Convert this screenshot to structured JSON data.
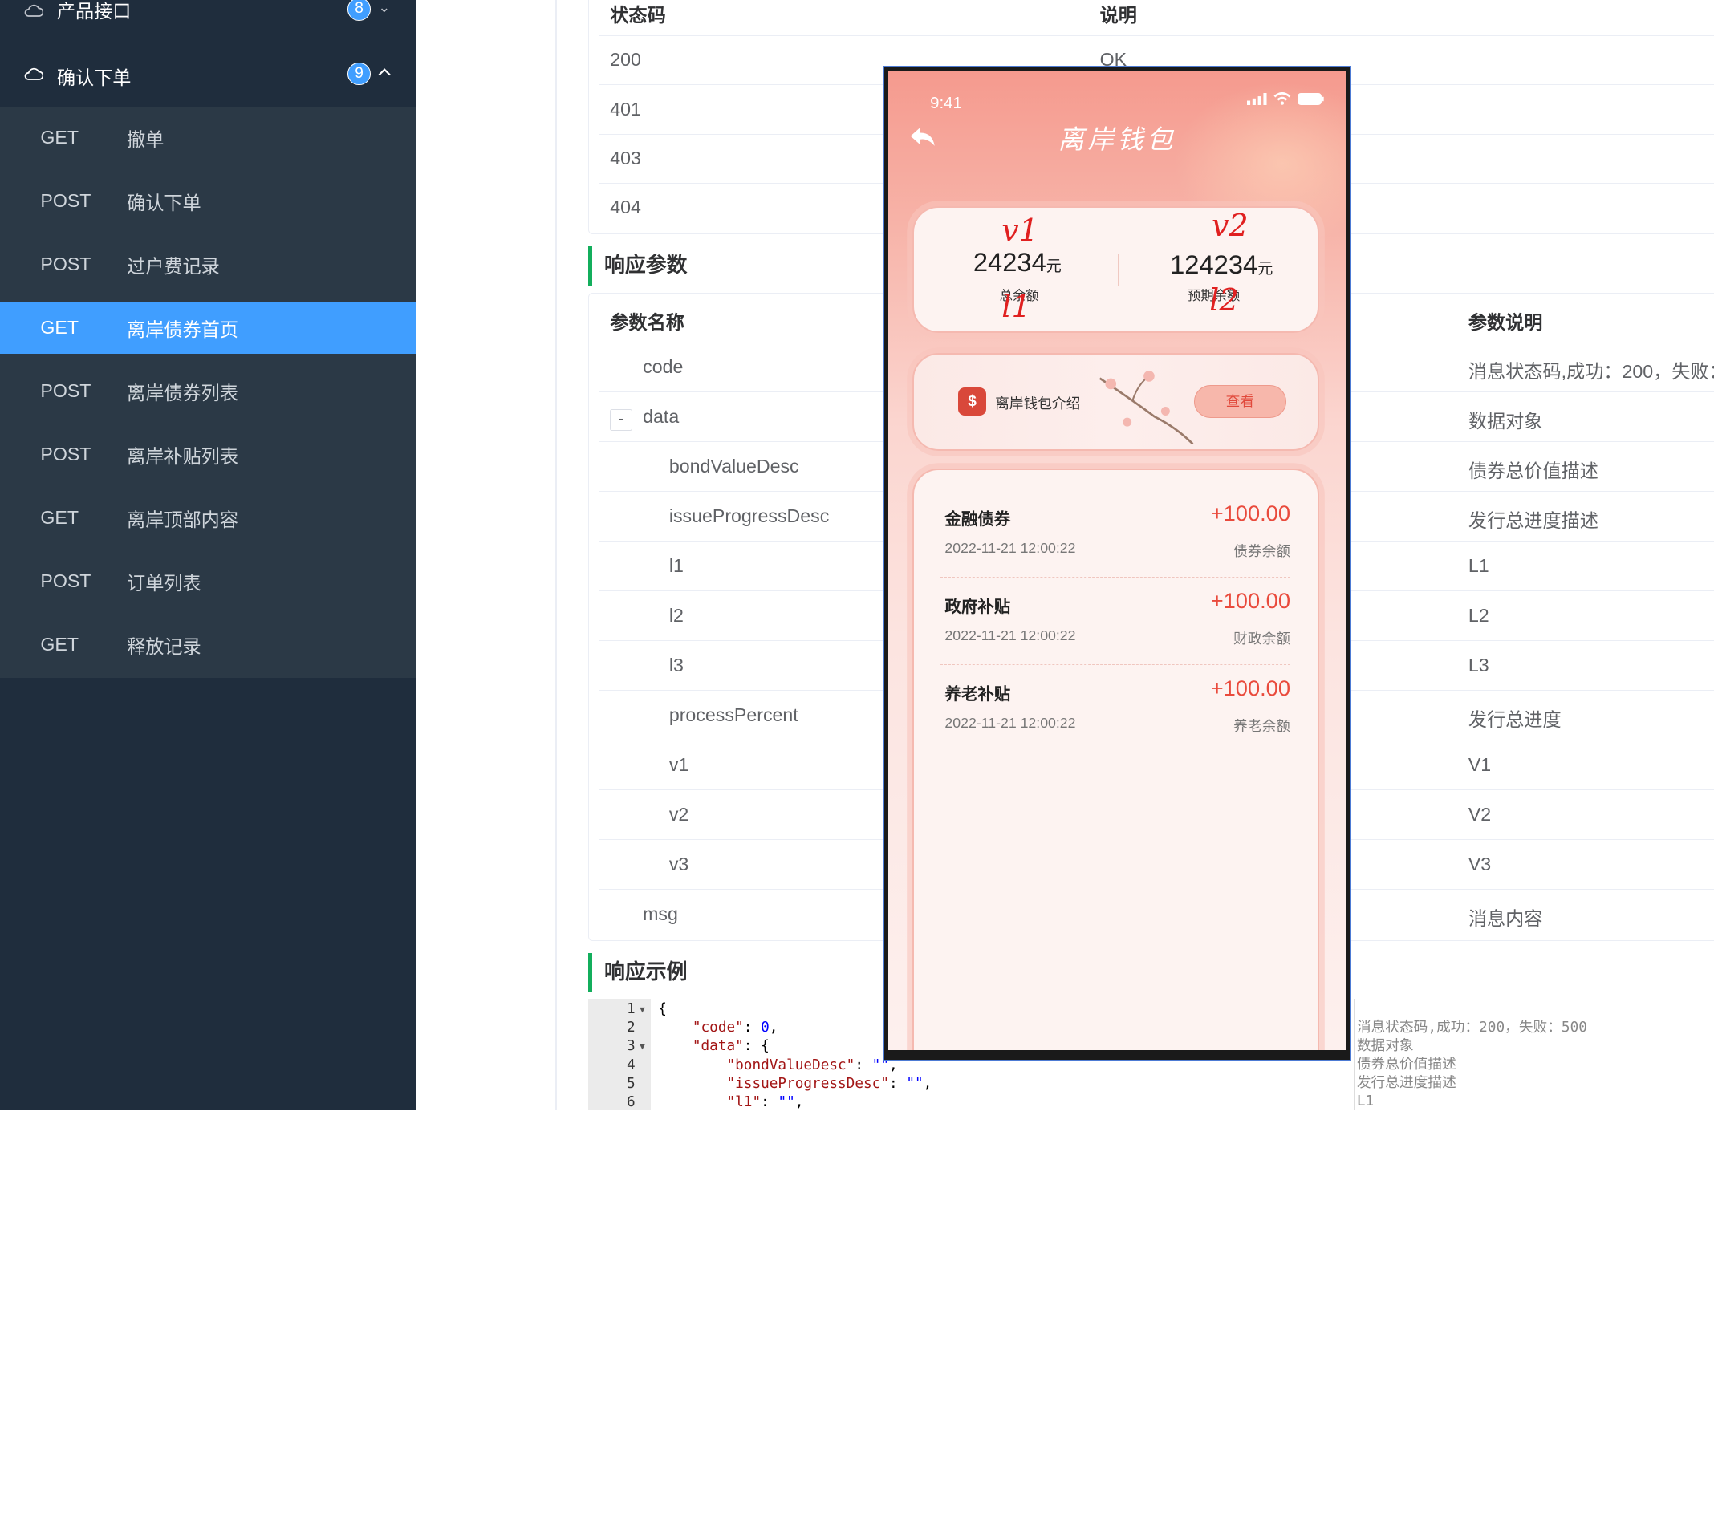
{
  "sidebar": {
    "groups": [
      {
        "title": "产品接口",
        "badge": "8"
      },
      {
        "title": "确认下单",
        "badge": "9"
      }
    ],
    "items": [
      {
        "method": "GET",
        "name": "撤单"
      },
      {
        "method": "POST",
        "name": "确认下单"
      },
      {
        "method": "POST",
        "name": "过户费记录"
      },
      {
        "method": "GET",
        "name": "离岸债券首页"
      },
      {
        "method": "POST",
        "name": "离岸债券列表"
      },
      {
        "method": "POST",
        "name": "离岸补贴列表"
      },
      {
        "method": "GET",
        "name": "离岸顶部内容"
      },
      {
        "method": "POST",
        "name": "订单列表"
      },
      {
        "method": "GET",
        "name": "释放记录"
      }
    ]
  },
  "status_table": {
    "headers": [
      "状态码",
      "说明"
    ],
    "rows": [
      {
        "code": "200",
        "desc": "OK"
      },
      {
        "code": "401",
        "desc": ""
      },
      {
        "code": "403",
        "desc": ""
      },
      {
        "code": "404",
        "desc": ""
      }
    ]
  },
  "response_params": {
    "title": "响应参数",
    "headers": [
      "参数名称",
      "参数说明"
    ],
    "toggle": "-",
    "rows": [
      {
        "name": "code",
        "desc": "消息状态码,成功：200，失败："
      },
      {
        "name": "data",
        "desc": "数据对象"
      },
      {
        "name": "bondValueDesc",
        "desc": "债券总价值描述"
      },
      {
        "name": "issueProgressDesc",
        "desc": "发行总进度描述"
      },
      {
        "name": "l1",
        "desc": "L1"
      },
      {
        "name": "l2",
        "desc": "L2"
      },
      {
        "name": "l3",
        "desc": "L3"
      },
      {
        "name": "processPercent",
        "desc": "发行总进度"
      },
      {
        "name": "v1",
        "desc": "V1"
      },
      {
        "name": "v2",
        "desc": "V2"
      },
      {
        "name": "v3",
        "desc": "V3"
      },
      {
        "name": "msg",
        "desc": "消息内容"
      }
    ]
  },
  "response_example": {
    "title": "响应示例",
    "line_numbers": [
      "1",
      "2",
      "3",
      "4",
      "5",
      "6"
    ],
    "side_notes": [
      "消息状态码,成功：200，失败：500",
      "数据对象",
      "债券总价值描述",
      "发行总进度描述",
      "L1"
    ]
  },
  "phone": {
    "time": "9:41",
    "title": "离岸钱包",
    "total_amount": "24234",
    "total_unit": "元",
    "total_label": "总余额",
    "expected_amount": "124234",
    "expected_unit": "元",
    "expected_label": "预期余额",
    "annotations": {
      "v1": "v1",
      "v2": "v2",
      "l1": "l1",
      "l2": "l2"
    },
    "intro_text": "离岸钱包介绍",
    "view_button": "查看",
    "list": [
      {
        "title": "金融债券",
        "date": "2022-11-21 12:00:22",
        "value": "+100.00",
        "sub": "债券余额"
      },
      {
        "title": "政府补贴",
        "date": "2022-11-21 12:00:22",
        "value": "+100.00",
        "sub": "财政余额"
      },
      {
        "title": "养老补贴",
        "date": "2022-11-21 12:00:22",
        "value": "+100.00",
        "sub": "养老余额"
      }
    ]
  },
  "colors": {
    "sidebar_bg": "#1f2d3d",
    "active": "#409eff",
    "accent_green": "#13ae5c",
    "amount_red": "#e94a3c"
  }
}
